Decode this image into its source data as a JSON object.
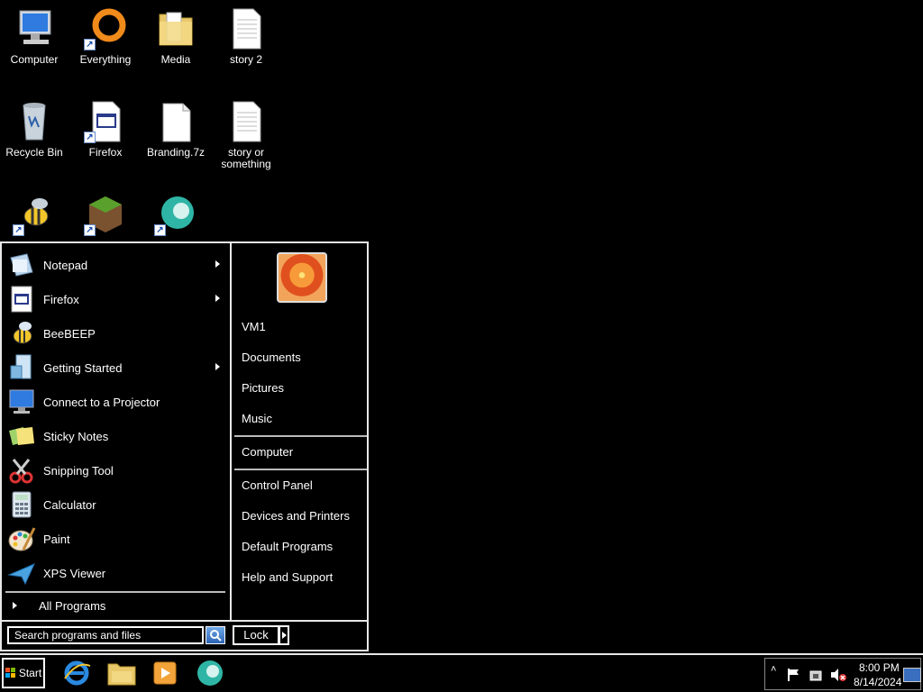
{
  "desktop": {
    "icons": [
      {
        "label": "Computer"
      },
      {
        "label": "Everything"
      },
      {
        "label": "Media"
      },
      {
        "label": "story 2"
      },
      {
        "label": "Recycle Bin"
      },
      {
        "label": "Firefox"
      },
      {
        "label": "Branding.7z"
      },
      {
        "label": "story or something"
      }
    ]
  },
  "start_menu": {
    "programs": [
      {
        "label": "Notepad"
      },
      {
        "label": "Firefox"
      },
      {
        "label": "BeeBEEP"
      },
      {
        "label": "Getting Started"
      },
      {
        "label": "Connect to a Projector"
      },
      {
        "label": "Sticky Notes"
      },
      {
        "label": "Snipping Tool"
      },
      {
        "label": "Calculator"
      },
      {
        "label": "Paint"
      },
      {
        "label": "XPS Viewer"
      }
    ],
    "all_programs": "All Programs",
    "right": {
      "user": "VM1",
      "documents": "Documents",
      "pictures": "Pictures",
      "music": "Music",
      "computer": "Computer",
      "control_panel": "Control Panel",
      "devices": "Devices and Printers",
      "default_programs": "Default Programs",
      "help": "Help and Support"
    },
    "search_value": "Search programs and files",
    "lock_label": "Lock"
  },
  "taskbar": {
    "start_label": "Start",
    "clock_time": "8:00 PM",
    "clock_date": "8/14/2024"
  }
}
